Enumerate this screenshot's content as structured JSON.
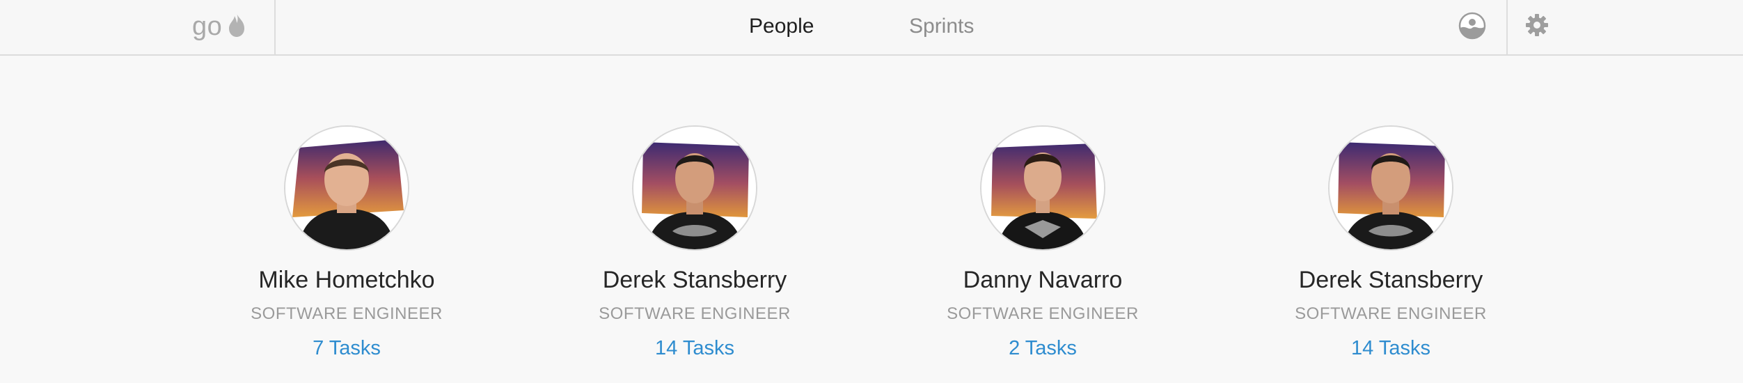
{
  "header": {
    "brand_text": "go",
    "brand_icon": "flame-icon",
    "tabs": [
      {
        "label": "People",
        "active": true
      },
      {
        "label": "Sprints",
        "active": false
      }
    ],
    "right_icons": [
      "user-avatar-icon",
      "gear-icon"
    ]
  },
  "people": [
    {
      "name": "Mike Hometchko",
      "role": "SOFTWARE ENGINEER",
      "tasks": "7 Tasks"
    },
    {
      "name": "Derek Stansberry",
      "role": "SOFTWARE ENGINEER",
      "tasks": "14 Tasks"
    },
    {
      "name": "Danny Navarro",
      "role": "SOFTWARE ENGINEER",
      "tasks": "2 Tasks"
    },
    {
      "name": "Derek Stansberry",
      "role": "SOFTWARE ENGINEER",
      "tasks": "14 Tasks"
    }
  ],
  "colors": {
    "accent_blue": "#2e8ccf",
    "muted_text": "#9a9a9a",
    "avatar_bg_purple": "#4a2a6a",
    "avatar_bg_orange": "#d98a3a"
  }
}
